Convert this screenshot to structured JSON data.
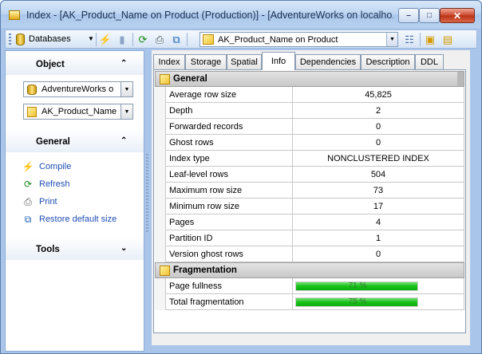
{
  "window": {
    "title": "Index - [AK_Product_Name on Product (Production)] - [AdventureWorks on localho...",
    "minimize_glyph": "–",
    "maximize_glyph": "□",
    "close_glyph": "✕"
  },
  "toolbar": {
    "databases_label": "Databases",
    "object_combo_value": "AK_Product_Name on Product",
    "icons": [
      "database-icon",
      "compile-icon",
      "db-disabled-icon",
      "refresh-icon",
      "print-icon",
      "restore-size-icon",
      "object-icon",
      "tree-icon",
      "object-props-icon",
      "restore-icon"
    ]
  },
  "left_panel": {
    "object_section": {
      "title": "Object",
      "database_combo": "AdventureWorks o",
      "object_combo": "AK_Product_Name"
    },
    "general_section": {
      "title": "General",
      "links": [
        {
          "label": "Compile",
          "icon": "lightning-icon"
        },
        {
          "label": "Refresh",
          "icon": "refresh-icon"
        },
        {
          "label": "Print",
          "icon": "printer-icon"
        },
        {
          "label": "Restore default size",
          "icon": "restore-size-icon"
        }
      ]
    },
    "tools_section": {
      "title": "Tools"
    }
  },
  "tabs": [
    {
      "label": "Index",
      "active": false
    },
    {
      "label": "Storage",
      "active": false
    },
    {
      "label": "Spatial",
      "active": false
    },
    {
      "label": "Info",
      "active": true
    },
    {
      "label": "Dependencies",
      "active": false
    },
    {
      "label": "Description",
      "active": false
    },
    {
      "label": "DDL",
      "active": false
    }
  ],
  "info": {
    "general_group": "General",
    "general_rows": [
      {
        "name": "Average row size",
        "value": "45,825"
      },
      {
        "name": "Depth",
        "value": "2"
      },
      {
        "name": "Forwarded records",
        "value": "0"
      },
      {
        "name": "Ghost rows",
        "value": "0"
      },
      {
        "name": "Index type",
        "value": "NONCLUSTERED INDEX"
      },
      {
        "name": "Leaf-level rows",
        "value": "504"
      },
      {
        "name": "Maximum row size",
        "value": "73"
      },
      {
        "name": "Minimum row size",
        "value": "17"
      },
      {
        "name": "Pages",
        "value": "4"
      },
      {
        "name": "Partition ID",
        "value": "1"
      },
      {
        "name": "Version ghost rows",
        "value": "0"
      }
    ],
    "fragmentation_group": "Fragmentation",
    "fragmentation_rows": [
      {
        "name": "Page fullness",
        "label": "71 %",
        "percent": 100
      },
      {
        "name": "Total fragmentation",
        "label": "75 %",
        "percent": 100
      }
    ]
  },
  "colors": {
    "link": "#1f4eb3",
    "progress_green": "#16c216"
  }
}
